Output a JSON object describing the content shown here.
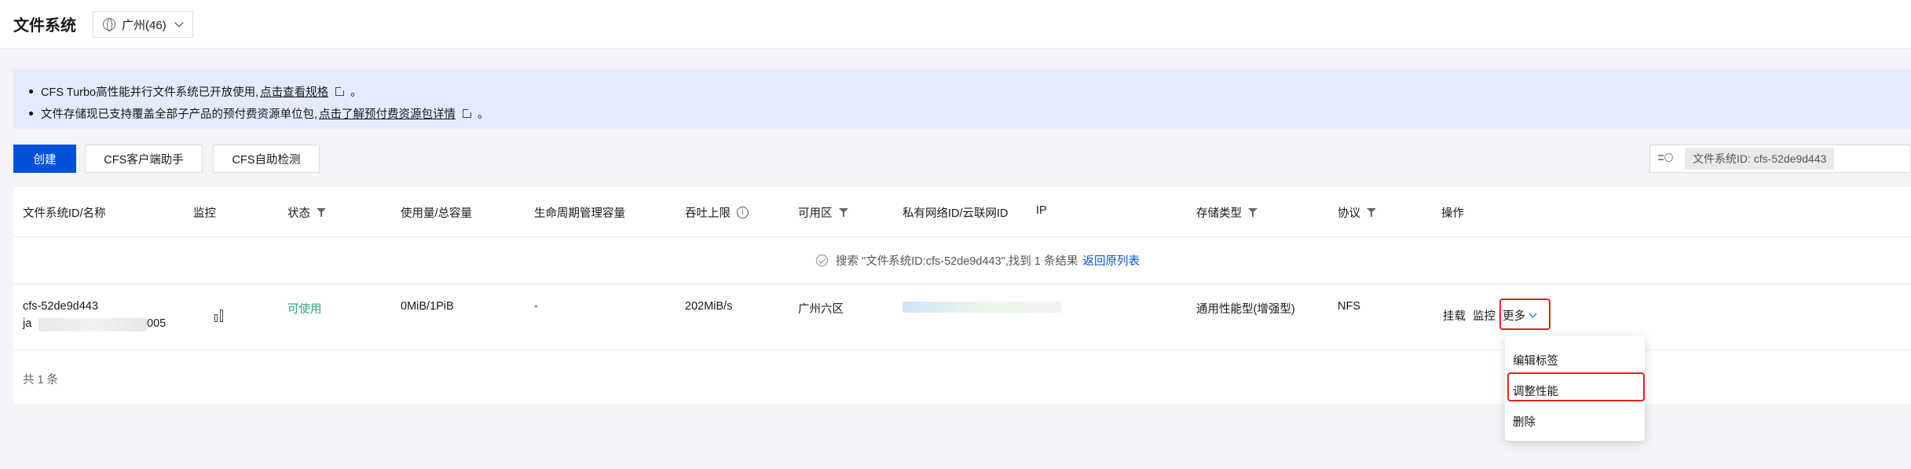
{
  "header": {
    "title": "文件系统",
    "region": "广州(46)"
  },
  "notice": {
    "line1_text": "CFS Turbo高性能并行文件系统已开放使用,",
    "line1_link": "点击查看规格",
    "line1_tail": "。",
    "line2_text": "文件存储现已支持覆盖全部子产品的预付费资源单位包,",
    "line2_link": "点击了解预付费资源包详情",
    "line2_tail": "。"
  },
  "toolbar": {
    "create": "创建",
    "client_helper": "CFS客户端助手",
    "self_check": "CFS自助检测"
  },
  "search": {
    "chip": "文件系统ID: cfs-52de9d443"
  },
  "table": {
    "columns": [
      "文件系统ID/名称",
      "监控",
      "状态",
      "使用量/总容量",
      "生命周期管理容量",
      "吞吐上限",
      "可用区",
      "私有网络ID/云联网ID",
      "IP",
      "存储类型",
      "协议",
      "操作"
    ],
    "search_result": "搜索 \"文件系统ID:cfs-52de9d443\",找到 1 条结果",
    "back_link": "返回原列表",
    "row": {
      "id": "cfs-52de9d443",
      "name_prefix": "ja",
      "name_suffix": "005",
      "status": "可使用",
      "usage": "0MiB/1PiB",
      "lifecycle": "-",
      "throughput": "202MiB/s",
      "zone": "广州六区",
      "storage_type": "通用性能型(增强型)",
      "protocol": "NFS",
      "actions": {
        "mount": "挂载",
        "monitor": "监控",
        "more": "更多"
      }
    },
    "total": "共 1 条"
  },
  "dropdown": {
    "items": [
      "编辑标签",
      "调整性能",
      "删除"
    ]
  },
  "colors": {
    "primary": "#0052d9",
    "success": "#2ba471",
    "highlight": "#e0251c",
    "notice_bg": "#e3ecfd"
  }
}
